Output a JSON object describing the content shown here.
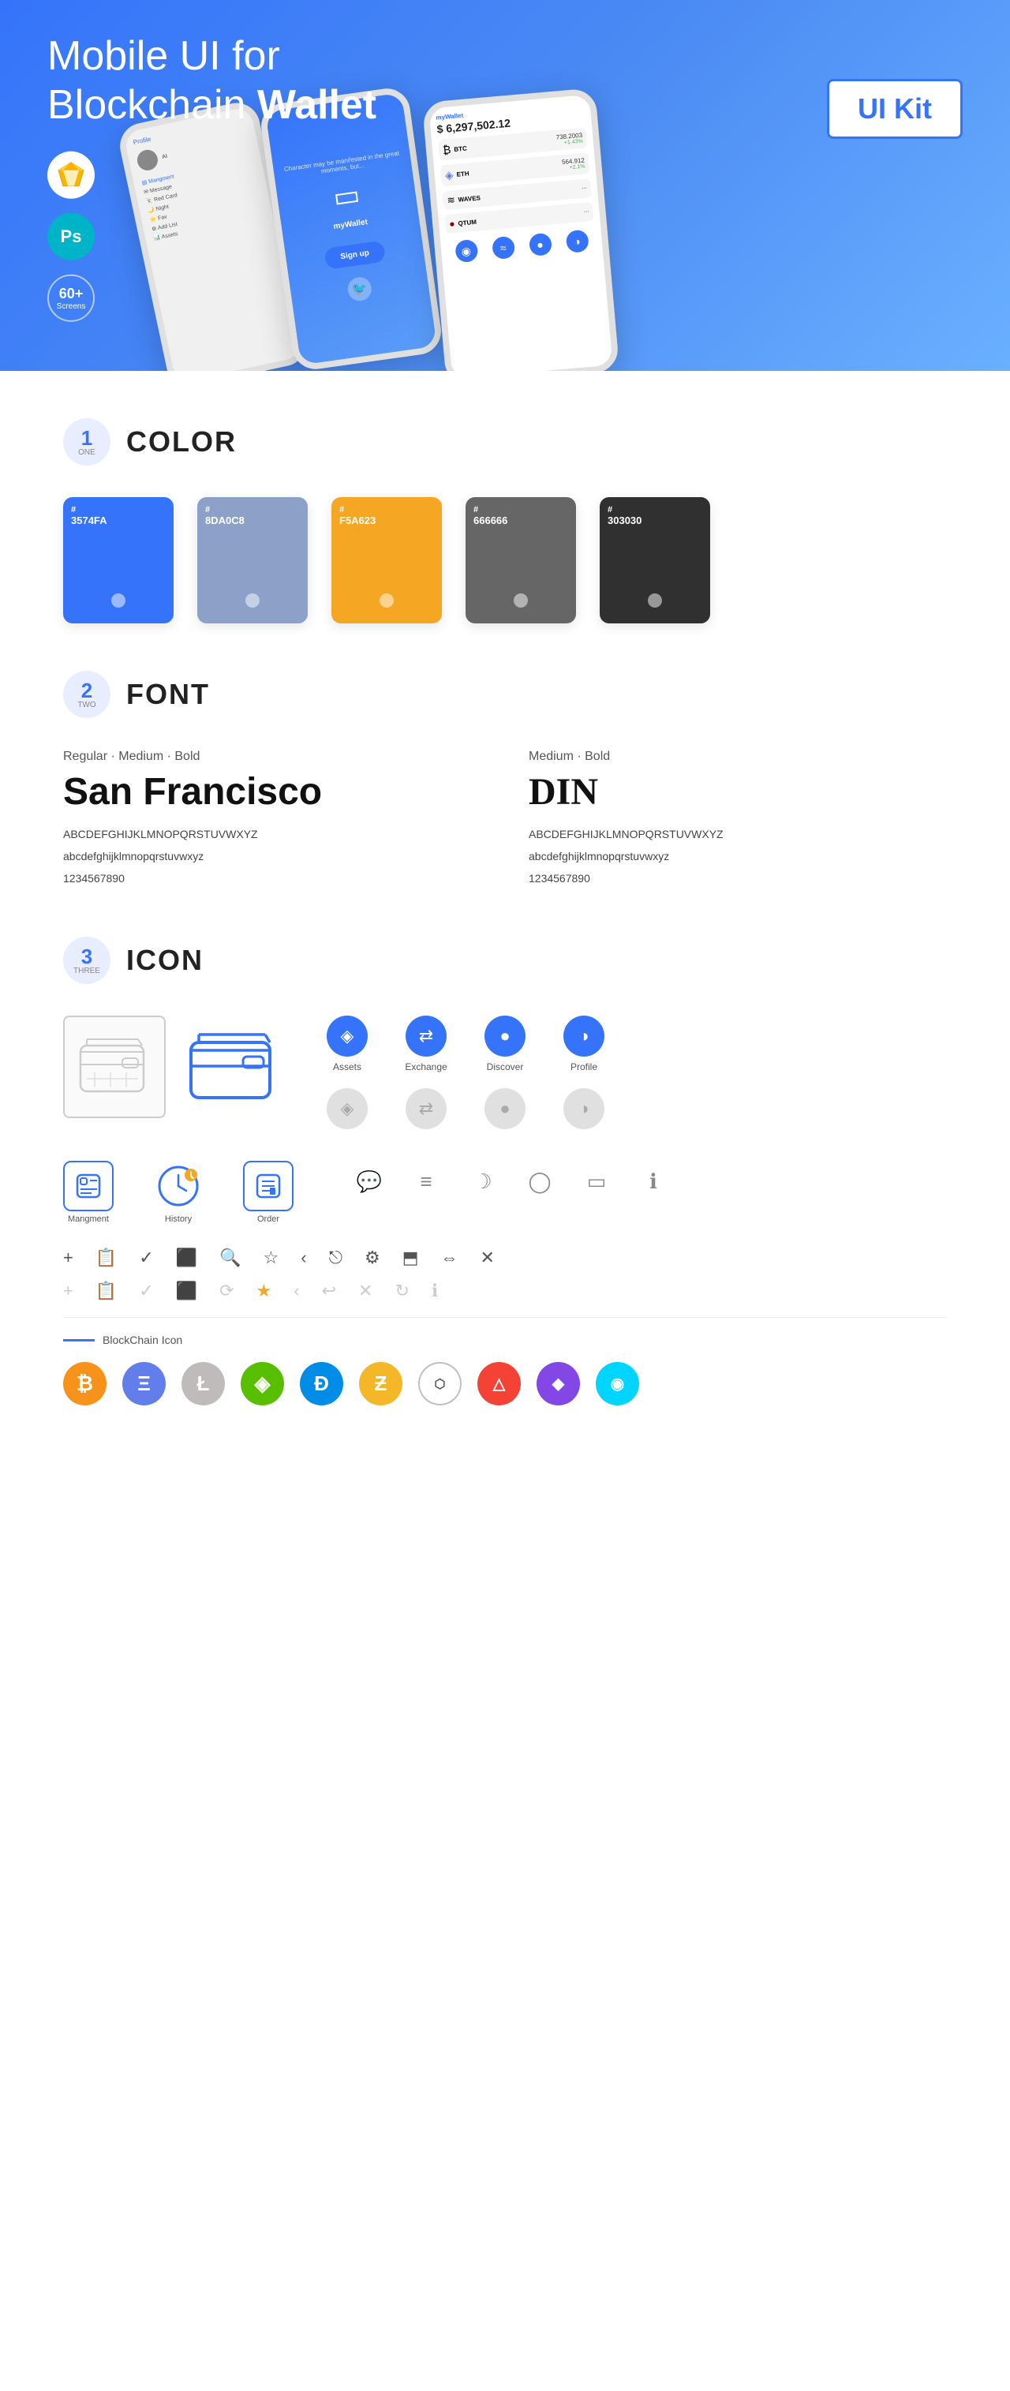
{
  "hero": {
    "title_normal": "Mobile UI for Blockchain ",
    "title_bold": "Wallet",
    "ui_kit_label": "UI Kit",
    "sketch_icon": "⬡",
    "ps_icon": "Ps",
    "count_num": "60+",
    "count_label": "Screens"
  },
  "sections": {
    "color": {
      "number": "1",
      "number_word": "ONE",
      "title": "COLOR",
      "swatches": [
        {
          "hex": "#3574FA",
          "code": "3574FA",
          "text_color": "#fff"
        },
        {
          "hex": "#8DA0C8",
          "code": "8DA0C8",
          "text_color": "#fff"
        },
        {
          "hex": "#F5A623",
          "code": "F5A623",
          "text_color": "#fff"
        },
        {
          "hex": "#666666",
          "code": "666666",
          "text_color": "#fff"
        },
        {
          "hex": "#303030",
          "code": "303030",
          "text_color": "#fff"
        }
      ]
    },
    "font": {
      "number": "2",
      "number_word": "TWO",
      "title": "FONT",
      "fonts": [
        {
          "weights": "Regular · Medium · Bold",
          "name": "San Francisco",
          "uppercase": "ABCDEFGHIJKLMNOPQRSTUVWXYZ",
          "lowercase": "abcdefghijklmnopqrstuvwxyz",
          "numbers": "1234567890"
        },
        {
          "weights": "Medium · Bold",
          "name": "DIN",
          "uppercase": "ABCDEFGHIJKLMNOPQRSTUVWXYZ",
          "lowercase": "abcdefghijklmnopqrstuvwxyz",
          "numbers": "1234567890"
        }
      ]
    },
    "icon": {
      "number": "3",
      "number_word": "THREE",
      "title": "ICON",
      "icon_labels": [
        "Assets",
        "Exchange",
        "Discover",
        "Profile"
      ],
      "bottom_icons": [
        "Mangment",
        "History",
        "Order"
      ],
      "blockchain_label": "BlockChain Icon",
      "crypto_icons": [
        "₿",
        "Ξ",
        "Ł",
        "◈",
        "Đ",
        "ℤ",
        "⬡",
        "Δ",
        "◆",
        "◉"
      ]
    }
  }
}
